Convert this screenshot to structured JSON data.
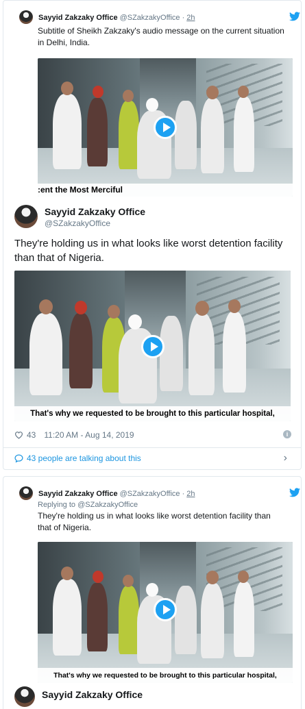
{
  "card1": {
    "quote": {
      "name": "Sayyid Zakzaky Office",
      "handle": "@SZakzakyOffice",
      "dot": "·",
      "time": "2h",
      "text": "Subtitle of Sheikh Zakzaky's audio message on the current situation in Delhi, India.",
      "video_caption": ":ent the Most Merciful"
    },
    "author": {
      "name": "Sayyid Zakzaky Office",
      "handle": "@SZakzakyOffice"
    },
    "text": "They're holding us in what looks like worst detention facility than that of Nigeria.",
    "video_caption": "That's why we requested to be brought to this particular hospital,",
    "likes": "43",
    "timestamp": "11:20 AM - Aug 14, 2019",
    "info_icon": "i",
    "talking": "43 people are talking about this",
    "chevron": "›"
  },
  "card2": {
    "quote": {
      "name": "Sayyid Zakzaky Office",
      "handle": "@SZakzakyOffice",
      "dot": "·",
      "time": "2h",
      "replying_prefix": "Replying to",
      "replying_to": "@SZakzakyOffice",
      "text": "They're holding us in what looks like worst detention facility than that of Nigeria.",
      "video_caption": "That's why we requested to be brought to this particular hospital,"
    },
    "author": {
      "name": "Sayyid Zakzaky Office"
    }
  },
  "colors": {
    "twitter_blue": "#1da1f2",
    "link_blue": "#1b95e0",
    "muted": "#657786"
  }
}
